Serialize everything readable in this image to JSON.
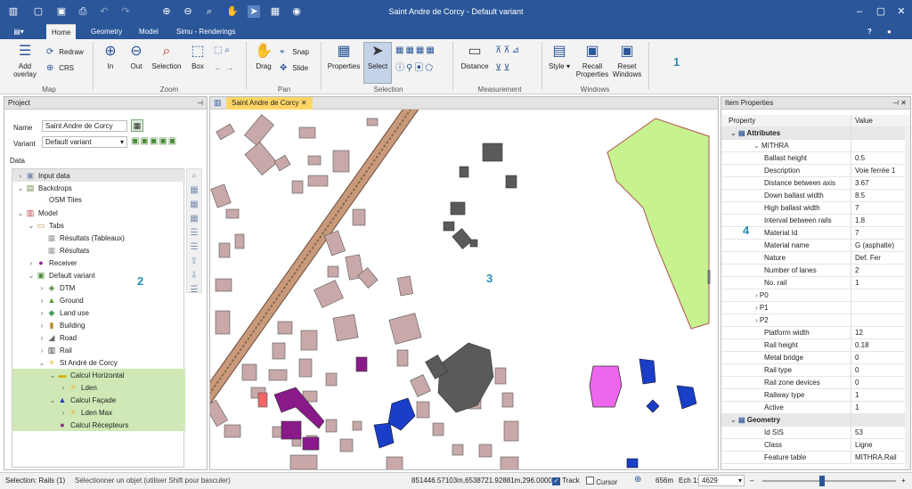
{
  "app": {
    "title": "Saint Andre de Corcy - Default variant",
    "accent": "#2b579a"
  },
  "qat": [
    "app-menu-icon",
    "new-icon",
    "save-icon",
    "print-icon",
    "undo-icon",
    "redo-icon",
    "zoom-in-icon",
    "zoom-out-icon",
    "zoom-search-icon",
    "pan-icon",
    "select-icon",
    "table-icon",
    "globe-icon"
  ],
  "tabs": [
    "Home",
    "Geometry",
    "Model",
    "Simu - Renderings"
  ],
  "ribbon": {
    "map": {
      "add_overlay": "Add\noverlay",
      "redraw": "Redraw",
      "crs": "CRS",
      "group": "Map"
    },
    "zoom": {
      "in": "In",
      "out": "Out",
      "selection": "Selection",
      "box": "Box",
      "group": "Zoom"
    },
    "pan": {
      "drag": "Drag",
      "snap": "Snap",
      "slide": "Slide",
      "group": "Pan"
    },
    "selection": {
      "properties": "Properties",
      "select": "Select",
      "group": "Selection"
    },
    "measurement": {
      "distance": "Distance",
      "group": "Measurement"
    },
    "windows": {
      "style": "Style",
      "recall": "Recall\nProperties",
      "reset": "Reset\nWindows",
      "group": "Windows"
    }
  },
  "callouts": {
    "c1": "1",
    "c2": "2",
    "c3": "3",
    "c4": "4"
  },
  "project": {
    "header": "Project",
    "name_label": "Name",
    "name_value": "Saint Andre de Corcy",
    "variant_label": "Variant",
    "variant_value": "Default variant",
    "data_label": "Data"
  },
  "tree": [
    {
      "label": "Input data",
      "indent": 0,
      "chev": ">",
      "icon": "doc",
      "hl": false,
      "muted": true
    },
    {
      "label": "Backdrops",
      "indent": 0,
      "chev": "v",
      "icon": "img",
      "hl": false
    },
    {
      "label": "OSM Tiles",
      "indent": 1,
      "chev": "",
      "icon": "",
      "hl": false
    },
    {
      "label": "Model",
      "indent": 0,
      "chev": "v",
      "icon": "chart",
      "hl": false
    },
    {
      "label": "Tabs",
      "indent": 1,
      "chev": "v",
      "icon": "folder",
      "hl": false
    },
    {
      "label": "Résultats (Tableaux)",
      "indent": 2,
      "chev": "",
      "icon": "grid",
      "hl": false
    },
    {
      "label": "Résultats",
      "indent": 2,
      "chev": "",
      "icon": "grid",
      "hl": false
    },
    {
      "label": "Receiver",
      "indent": 1,
      "chev": ">",
      "icon": "recv",
      "hl": false
    },
    {
      "label": "Default variant",
      "indent": 1,
      "chev": "v",
      "icon": "variant",
      "hl": false
    },
    {
      "label": "DTM",
      "indent": 2,
      "chev": ">",
      "icon": "dtm",
      "hl": false
    },
    {
      "label": "Ground",
      "indent": 2,
      "chev": ">",
      "icon": "ground",
      "hl": false
    },
    {
      "label": "Land use",
      "indent": 2,
      "chev": ">",
      "icon": "land",
      "hl": false
    },
    {
      "label": "Building",
      "indent": 2,
      "chev": ">",
      "icon": "bld",
      "hl": false
    },
    {
      "label": "Road",
      "indent": 2,
      "chev": ">",
      "icon": "road",
      "hl": false
    },
    {
      "label": "Rail",
      "indent": 2,
      "chev": ">",
      "icon": "rail",
      "hl": false
    },
    {
      "label": "St André de Corcy",
      "indent": 2,
      "chev": "v",
      "icon": "sun",
      "hl": false
    },
    {
      "label": "Calcul Horizontal",
      "indent": 3,
      "chev": "v",
      "icon": "calc",
      "hl": true
    },
    {
      "label": "Lden",
      "indent": 4,
      "chev": ">",
      "icon": "sun",
      "hl": true
    },
    {
      "label": "Calcul Façade",
      "indent": 3,
      "chev": "v",
      "icon": "fac",
      "hl": true
    },
    {
      "label": "Lden Max",
      "indent": 4,
      "chev": ">",
      "icon": "sun",
      "hl": true
    },
    {
      "label": "Calcul Récepteurs",
      "indent": 3,
      "chev": "",
      "icon": "recv",
      "hl": true
    }
  ],
  "map": {
    "tab": "Saint Andre de Corcy"
  },
  "item_properties": {
    "header": "Item Properties",
    "col_property": "Property",
    "col_value": "Value",
    "rows": [
      {
        "name": "Attributes",
        "value": "",
        "type": "cat"
      },
      {
        "name": "MITHRA",
        "value": "",
        "type": "sub"
      },
      {
        "name": "Ballast height",
        "value": "0.5"
      },
      {
        "name": "Description",
        "value": "Voie ferrée 1"
      },
      {
        "name": "Distance between axis",
        "value": "3.67"
      },
      {
        "name": "Down ballast width",
        "value": "8.5"
      },
      {
        "name": "High ballast width",
        "value": "7"
      },
      {
        "name": "Interval between rails",
        "value": "1.8"
      },
      {
        "name": "Material Id",
        "value": "7"
      },
      {
        "name": "Material name",
        "value": "G (asphalte)"
      },
      {
        "name": "Nature",
        "value": "Def. Fer"
      },
      {
        "name": "Number of lanes",
        "value": "2"
      },
      {
        "name": "No. rail",
        "value": "1"
      },
      {
        "name": "P0",
        "value": "",
        "type": "exp"
      },
      {
        "name": "P1",
        "value": "",
        "type": "exp"
      },
      {
        "name": "P2",
        "value": "",
        "type": "exp"
      },
      {
        "name": "Platform width",
        "value": "12"
      },
      {
        "name": "Rail height",
        "value": "0.18"
      },
      {
        "name": "Metal bridge",
        "value": "0"
      },
      {
        "name": "Rail type",
        "value": "0"
      },
      {
        "name": "Rail zone devices",
        "value": "0"
      },
      {
        "name": "Railway type",
        "value": "1"
      },
      {
        "name": "Active",
        "value": "1"
      },
      {
        "name": "Geometry",
        "value": "",
        "type": "cat"
      },
      {
        "name": "Id SIS",
        "value": "53"
      },
      {
        "name": "Class",
        "value": "Ligne"
      },
      {
        "name": "Feature table",
        "value": "MITHRA.Rail"
      }
    ]
  },
  "status": {
    "selection": "Selection: Rails (1)",
    "hint": "Sélectionner un objet (utiliser Shift pour basculer)",
    "coords": "851446.57103m,6538721.92881m,296.0000",
    "track": "Track",
    "cursor": "Cursor",
    "scale_dist": "656m",
    "scale_label": "Ech 1:",
    "scale_value": "4629"
  }
}
